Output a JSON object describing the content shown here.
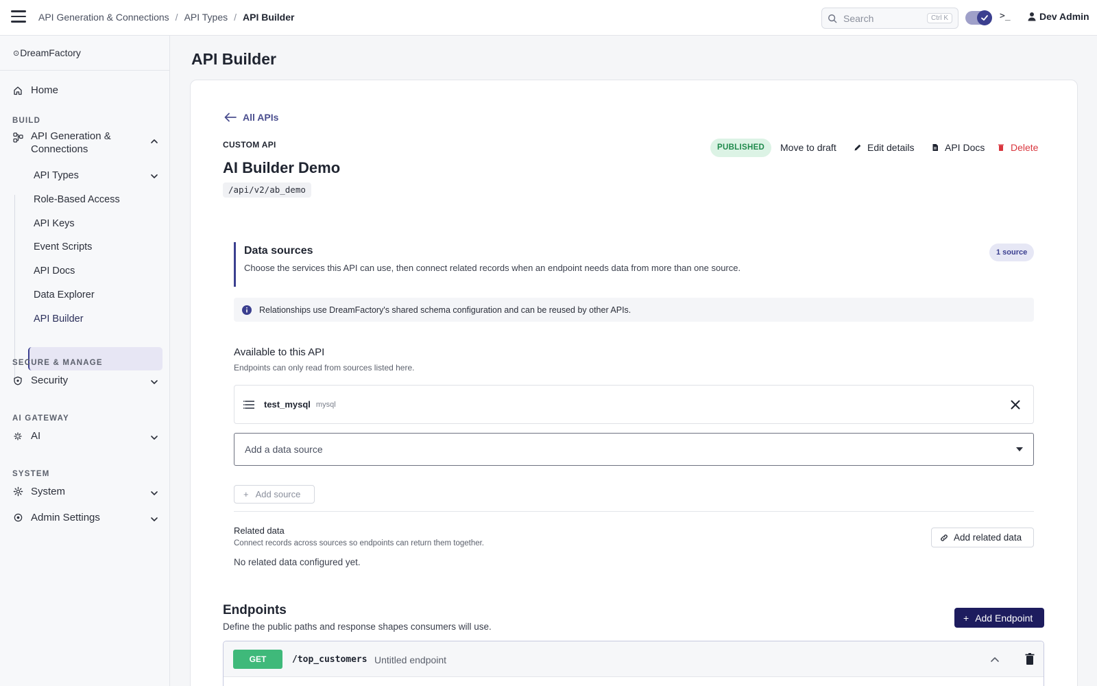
{
  "topbar": {
    "breadcrumbs": [
      "API Generation & Connections",
      "API Types",
      "API Builder"
    ],
    "separator": "/",
    "search_placeholder": "Search",
    "search_shortcut": "Ctrl K",
    "terminal_label": ">_",
    "user_name": "Dev Admin"
  },
  "sidebar": {
    "logo": "DreamFactory",
    "logo_mark": "⊙",
    "home": "Home",
    "sections": {
      "build": "BUILD",
      "secure": "SECURE & MANAGE",
      "ai_gateway": "AI GATEWAY",
      "system": "SYSTEM"
    },
    "api_gen_line1": "API Generation &",
    "api_gen_line2": "Connections",
    "sub_items": [
      "API Types",
      "Role-Based Access",
      "API Keys",
      "Event Scripts",
      "API Docs",
      "Data Explorer",
      "API Builder"
    ],
    "active_item": "API Builder",
    "security": "Security",
    "ai": "AI",
    "system": "System",
    "admin_settings": "Admin Settings"
  },
  "main": {
    "page_title": "API Builder",
    "back_label": "All APIs",
    "eyebrow": "CUSTOM API",
    "api_name": "AI Builder Demo",
    "api_path": "/api/v2/ab_demo",
    "status_badge": "PUBLISHED",
    "actions": {
      "move_to_draft": "Move to draft",
      "edit_details": "Edit details",
      "api_docs": "API Docs",
      "delete": "Delete"
    }
  },
  "data_sources": {
    "title": "Data sources",
    "description": "Choose the services this API can use, then connect related records when an endpoint needs data from more than one source.",
    "count_badge": "1 source",
    "info_text": "Relationships use DreamFactory's shared schema configuration and can be reused by other APIs.",
    "available_title": "Available to this API",
    "available_desc": "Endpoints can only read from sources listed here.",
    "sources": [
      {
        "name": "test_mysql",
        "type": "mysql"
      }
    ],
    "select_placeholder": "Add a data source",
    "add_source_label": "Add source",
    "related_title": "Related data",
    "related_desc": "Connect records across sources so endpoints can return them together.",
    "related_empty": "No related data configured yet.",
    "add_related_label": "Add related data"
  },
  "endpoints": {
    "title": "Endpoints",
    "description": "Define the public paths and response shapes consumers will use.",
    "add_label": "Add Endpoint",
    "items": [
      {
        "method": "GET",
        "path": "/top_customers",
        "name": "Untitled endpoint"
      }
    ]
  },
  "colors": {
    "accent": "#3b3f8f",
    "primary_button": "#1d1c5e",
    "published_bg": "#dcf3e5",
    "published_text": "#1f8a4c",
    "danger": "#d9363e",
    "get_method": "#3fb97a"
  }
}
